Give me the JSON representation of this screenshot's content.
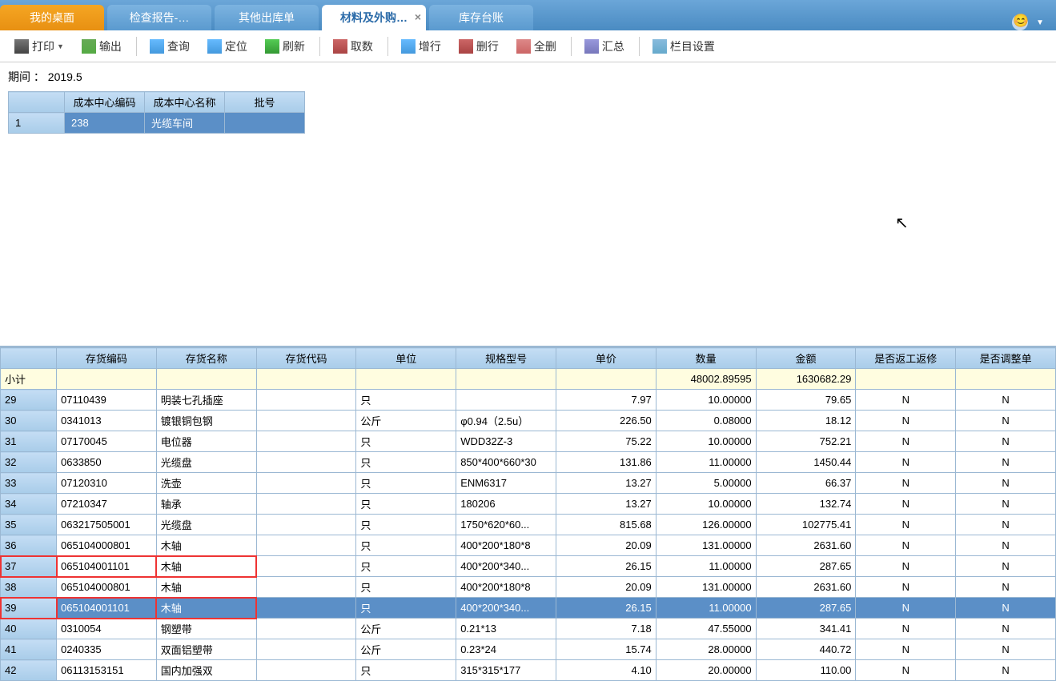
{
  "tabs": [
    {
      "label": "我的桌面",
      "kind": "home"
    },
    {
      "label": "检查报告-…",
      "kind": "normal"
    },
    {
      "label": "其他出库单",
      "kind": "normal"
    },
    {
      "label": "材料及外购…",
      "kind": "active",
      "closable": true
    },
    {
      "label": "库存台账",
      "kind": "normal"
    }
  ],
  "toolbar": [
    {
      "id": "print",
      "label": "打印",
      "dropdown": true
    },
    {
      "id": "export",
      "label": "输出"
    },
    null,
    {
      "id": "query",
      "label": "查询"
    },
    {
      "id": "locate",
      "label": "定位"
    },
    {
      "id": "refresh",
      "label": "刷新"
    },
    null,
    {
      "id": "fetch",
      "label": "取数"
    },
    null,
    {
      "id": "addrow",
      "label": "增行"
    },
    {
      "id": "delrow",
      "label": "删行"
    },
    {
      "id": "delall",
      "label": "全删"
    },
    null,
    {
      "id": "summary",
      "label": "汇总"
    },
    null,
    {
      "id": "colset",
      "label": "栏目设置"
    }
  ],
  "period": {
    "label": "期间",
    "value": "2019.5"
  },
  "topTable": {
    "headers": [
      "成本中心编码",
      "成本中心名称",
      "批号"
    ],
    "rows": [
      {
        "n": "1",
        "code": "238",
        "name": "光缆车间",
        "batch": ""
      }
    ]
  },
  "mainTable": {
    "headers": [
      "存货编码",
      "存货名称",
      "存货代码",
      "单位",
      "规格型号",
      "单价",
      "数量",
      "金额",
      "是否返工返修",
      "是否调整单"
    ],
    "subtotal": {
      "label": "小计",
      "qty": "48002.89595",
      "amt": "1630682.29"
    },
    "rows": [
      {
        "n": "29",
        "code": "07110439",
        "name": "明装七孔插座",
        "alt": "",
        "unit": "只",
        "spec": "",
        "price": "7.97",
        "qty": "10.00000",
        "amt": "79.65",
        "rw": "N",
        "adj": "N"
      },
      {
        "n": "30",
        "code": "0341013",
        "name": "镀银铜包钢",
        "alt": "",
        "unit": "公斤",
        "spec": "φ0.94（2.5u）",
        "price": "226.50",
        "qty": "0.08000",
        "amt": "18.12",
        "rw": "N",
        "adj": "N"
      },
      {
        "n": "31",
        "code": "07170045",
        "name": "电位器",
        "alt": "",
        "unit": "只",
        "spec": "WDD32Z-3",
        "price": "75.22",
        "qty": "10.00000",
        "amt": "752.21",
        "rw": "N",
        "adj": "N"
      },
      {
        "n": "32",
        "code": "0633850",
        "name": "光缆盘",
        "alt": "",
        "unit": "只",
        "spec": "850*400*660*30",
        "price": "131.86",
        "qty": "11.00000",
        "amt": "1450.44",
        "rw": "N",
        "adj": "N"
      },
      {
        "n": "33",
        "code": "07120310",
        "name": "洗壶",
        "alt": "",
        "unit": "只",
        "spec": "ENM6317",
        "price": "13.27",
        "qty": "5.00000",
        "amt": "66.37",
        "rw": "N",
        "adj": "N"
      },
      {
        "n": "34",
        "code": "07210347",
        "name": "轴承",
        "alt": "",
        "unit": "只",
        "spec": "180206",
        "price": "13.27",
        "qty": "10.00000",
        "amt": "132.74",
        "rw": "N",
        "adj": "N"
      },
      {
        "n": "35",
        "code": "063217505001",
        "name": "光缆盘",
        "alt": "",
        "unit": "只",
        "spec": "1750*620*60...",
        "price": "815.68",
        "qty": "126.00000",
        "amt": "102775.41",
        "rw": "N",
        "adj": "N"
      },
      {
        "n": "36",
        "code": "065104000801",
        "name": "木轴",
        "alt": "",
        "unit": "只",
        "spec": "400*200*180*8",
        "price": "20.09",
        "qty": "131.00000",
        "amt": "2631.60",
        "rw": "N",
        "adj": "N"
      },
      {
        "n": "37",
        "code": "065104001101",
        "name": "木轴",
        "alt": "",
        "unit": "只",
        "spec": "400*200*340...",
        "price": "26.15",
        "qty": "11.00000",
        "amt": "287.65",
        "rw": "N",
        "adj": "N",
        "mark": true
      },
      {
        "n": "38",
        "code": "065104000801",
        "name": "木轴",
        "alt": "",
        "unit": "只",
        "spec": "400*200*180*8",
        "price": "20.09",
        "qty": "131.00000",
        "amt": "2631.60",
        "rw": "N",
        "adj": "N"
      },
      {
        "n": "39",
        "code": "065104001101",
        "name": "木轴",
        "alt": "",
        "unit": "只",
        "spec": "400*200*340...",
        "price": "26.15",
        "qty": "11.00000",
        "amt": "287.65",
        "rw": "N",
        "adj": "N",
        "mark": true,
        "sel": true
      },
      {
        "n": "40",
        "code": "0310054",
        "name": "钢塑带",
        "alt": "",
        "unit": "公斤",
        "spec": "0.21*13",
        "price": "7.18",
        "qty": "47.55000",
        "amt": "341.41",
        "rw": "N",
        "adj": "N"
      },
      {
        "n": "41",
        "code": "0240335",
        "name": "双面铝塑带",
        "alt": "",
        "unit": "公斤",
        "spec": "0.23*24",
        "price": "15.74",
        "qty": "28.00000",
        "amt": "440.72",
        "rw": "N",
        "adj": "N"
      },
      {
        "n": "42",
        "code": "06113153151",
        "name": "国内加强双",
        "alt": "",
        "unit": "只",
        "spec": "315*315*177",
        "price": "4.10",
        "qty": "20.00000",
        "amt": "110.00",
        "rw": "N",
        "adj": "N"
      }
    ]
  },
  "colWidths": {
    "rn": 70,
    "code": 115,
    "name": 115,
    "alt": 115,
    "unit": 115,
    "spec": 115,
    "price": 115,
    "qty": 115,
    "amt": 115,
    "rw": 115,
    "adj": 115
  }
}
